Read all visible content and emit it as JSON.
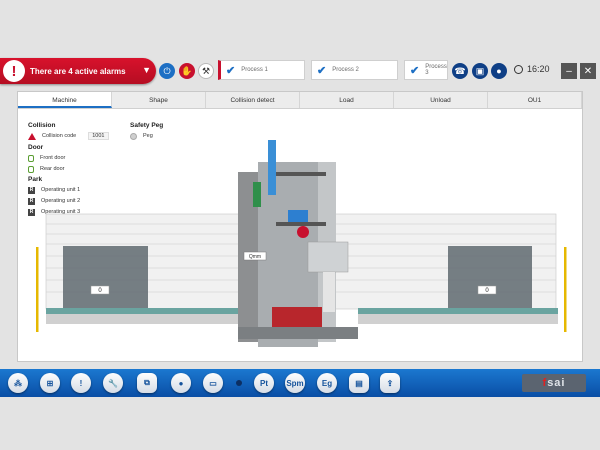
{
  "alarm": {
    "text": "There are 4 active alarms",
    "color": "#c8102e"
  },
  "processes": [
    "Process 1",
    "Process 2",
    "Process 3"
  ],
  "clock": "16:20",
  "tabs": [
    "Machine",
    "Shape",
    "Collision detect",
    "Load",
    "Unload",
    "OU1"
  ],
  "collision": {
    "title": "Collision",
    "label": "Collision code",
    "code": "1001"
  },
  "safety_peg": {
    "title": "Safety Peg",
    "label": "Peg"
  },
  "door": {
    "title": "Door",
    "front": "Front door",
    "rear": "Rear door"
  },
  "park": {
    "title": "Park",
    "units": [
      "Operating unit 1",
      "Operating unit 2",
      "Operating unit 3"
    ]
  },
  "machine": {
    "left_value": "0",
    "right_value": "0",
    "badge": "Qmm"
  },
  "dock": {
    "pt": "Pt",
    "spm": "Spm",
    "eg": "Eg",
    "logo_a": "f",
    "logo_b": "sai"
  },
  "colors": {
    "accent": "#1d6fc4",
    "dock": "#0a4ea5",
    "alarm": "#c8102e"
  }
}
